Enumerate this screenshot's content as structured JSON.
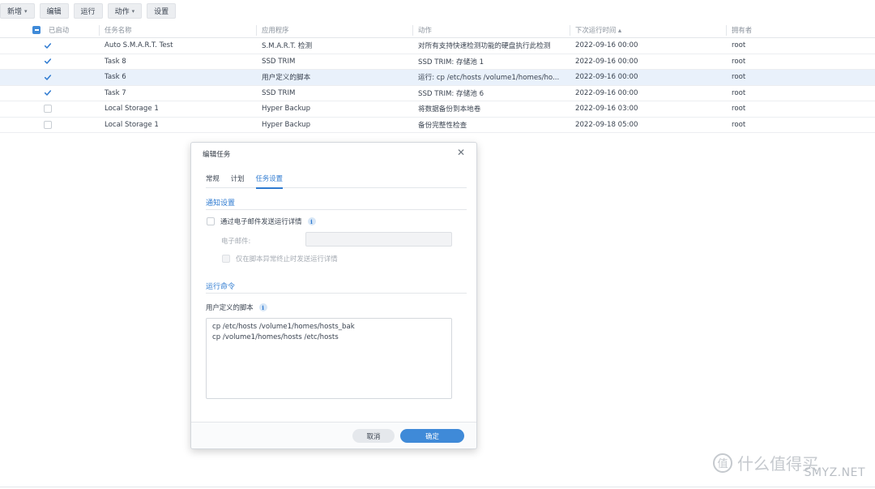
{
  "toolbar": {
    "create": "新增",
    "edit": "编辑",
    "run": "运行",
    "action": "动作",
    "settings": "设置"
  },
  "table": {
    "headers": {
      "enabled": "已启动",
      "name": "任务名称",
      "app": "应用程序",
      "action": "动作",
      "next_run": "下次运行时间 ▴",
      "owner": "拥有者"
    },
    "rows": [
      {
        "enabled": true,
        "name": "Auto S.M.A.R.T. Test",
        "app": "S.M.A.R.T. 检测",
        "action": "对所有支持快速检测功能的硬盘执行此检测",
        "next_run": "2022-09-16 00:00",
        "owner": "root"
      },
      {
        "enabled": true,
        "name": "Task 8",
        "app": "SSD TRIM",
        "action": "SSD TRIM: 存储池 1",
        "next_run": "2022-09-16 00:00",
        "owner": "root"
      },
      {
        "enabled": true,
        "name": "Task 6",
        "app": "用户定义的脚本",
        "action": "运行: cp /etc/hosts /volume1/homes/ho...",
        "next_run": "2022-09-16 00:00",
        "owner": "root"
      },
      {
        "enabled": true,
        "name": "Task 7",
        "app": "SSD TRIM",
        "action": "SSD TRIM: 存储池 6",
        "next_run": "2022-09-16 00:00",
        "owner": "root"
      },
      {
        "enabled": false,
        "name": "Local Storage 1",
        "app": "Hyper Backup",
        "action": "将数据备份到本地卷",
        "next_run": "2022-09-16 03:00",
        "owner": "root"
      },
      {
        "enabled": false,
        "name": "Local Storage 1",
        "app": "Hyper Backup",
        "action": "备份完整性检查",
        "next_run": "2022-09-18 05:00",
        "owner": "root"
      }
    ]
  },
  "dialog": {
    "title": "编辑任务",
    "tabs": [
      "常规",
      "计划",
      "任务设置"
    ],
    "notify_section": "通知设置",
    "send_email_label": "通过电子邮件发送运行详情",
    "email_label": "电子邮件:",
    "email_value": "",
    "only_abnormal_label": "仅在脚本异常终止时发送运行详情",
    "run_section": "运行命令",
    "script_label": "用户定义的脚本",
    "script_text": "cp /etc/hosts /volume1/homes/hosts_bak\ncp /volume1/homes/hosts /etc/hosts",
    "cancel": "取消",
    "ok": "确定"
  },
  "watermark": {
    "logo_char": "值",
    "text": "什么值得买",
    "site": "SMYZ.NET"
  },
  "colors": {
    "accent": "#3f8ad8",
    "selected_row": "#e9f1fb"
  }
}
